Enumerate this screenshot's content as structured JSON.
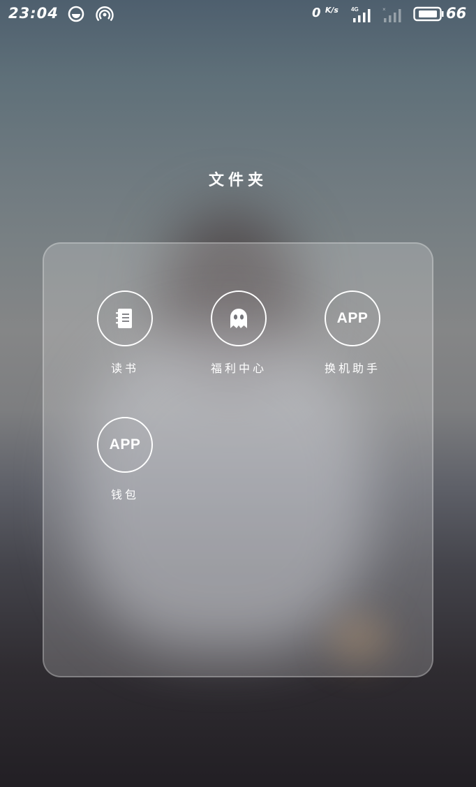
{
  "status_bar": {
    "time": "23:04",
    "net_speed_value": "0",
    "net_speed_unit": "K/s",
    "network_type": "4G",
    "battery_level": "66",
    "icons": [
      "browser-circle-icon",
      "hotspot-icon",
      "signal-4g-icon",
      "signal-empty-icon",
      "battery-icon"
    ]
  },
  "folder": {
    "title": "文件夹",
    "apps": [
      {
        "label": "读书",
        "icon": "notebook-icon"
      },
      {
        "label": "福利中心",
        "icon": "ghost-icon"
      },
      {
        "label": "换机助手",
        "icon": "app-placeholder-icon",
        "icon_text": "APP"
      },
      {
        "label": "钱包",
        "icon": "app-placeholder-icon",
        "icon_text": "APP"
      }
    ]
  },
  "colors": {
    "foreground": "#ffffff",
    "panel_background": "rgba(235,235,238,0.22)"
  }
}
